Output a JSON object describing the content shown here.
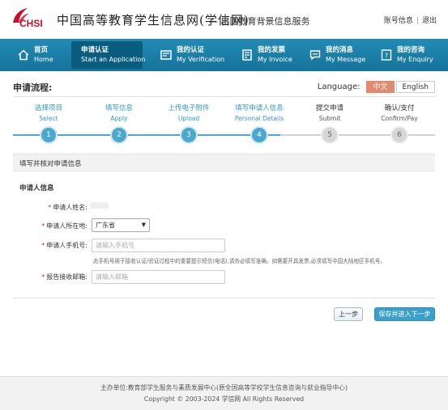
{
  "header": {
    "logo_text": "CHSI",
    "site_title": "中国高等教育学生信息网(学信网)",
    "site_subtitle": "— 出国教育背景信息服务",
    "account_link": "账号信息",
    "logout_link": "退出"
  },
  "nav": [
    {
      "cn": "首页",
      "en": "Home",
      "icon": "home-icon"
    },
    {
      "cn": "申请认证",
      "en": "Start an Application",
      "icon": "checkbox-icon"
    },
    {
      "cn": "我的认证",
      "en": "My Verification",
      "icon": "document-icon"
    },
    {
      "cn": "我的发票",
      "en": "My Invoice",
      "icon": "invoice-icon"
    },
    {
      "cn": "我的消息",
      "en": "My Message",
      "icon": "chat-icon"
    },
    {
      "cn": "我的咨询",
      "en": "My Enquiry",
      "icon": "question-icon"
    }
  ],
  "process": {
    "title": "申请流程:",
    "language_label": "Language:",
    "lang_cn": "中文",
    "lang_en": "English",
    "steps": [
      {
        "cn": "选择项目",
        "en": "Select",
        "num": "1"
      },
      {
        "cn": "填写信息",
        "en": "Apply",
        "num": "2"
      },
      {
        "cn": "上传电子附件",
        "en": "Upload",
        "num": "3"
      },
      {
        "cn": "填写申请人信息",
        "en": "Personal Details",
        "num": "4"
      },
      {
        "cn": "提交申请",
        "en": "Submit",
        "num": "5"
      },
      {
        "cn": "确认/支付",
        "en": "Confirm/Pay",
        "num": "6"
      }
    ]
  },
  "form": {
    "panel_title": "填写并核对申请信息",
    "section_title": "申请人信息",
    "name_label": "申请人姓名:",
    "location_label": "申请人所在地:",
    "location_value": "广东省",
    "phone_label": "申请人手机号:",
    "phone_placeholder": "请输入手机号",
    "phone_hint": "此手机号用于接收认证/验证过程中的重要提示短信(电话),请务必填写准确。如需要开具发票,必须填写中国大陆地区手机号。",
    "email_label": "报告接收邮箱:",
    "email_placeholder": "请输入邮箱",
    "prev_button": "上一步",
    "next_button": "保存并进入下一步"
  },
  "footer": {
    "line1": "主办单位:教育部学生服务与素质发展中心(原全国高等学校学生信息咨询与就业指导中心)",
    "line2": "Copyright © 2003-2024 学信网 All Rights Reserved"
  },
  "colors": {
    "nav_bg": "#1a7fa6",
    "nav_active": "#0b5d80",
    "step_done": "#4aa8cf",
    "lang_active": "#e08a6f",
    "brand_red": "#c8102e"
  }
}
